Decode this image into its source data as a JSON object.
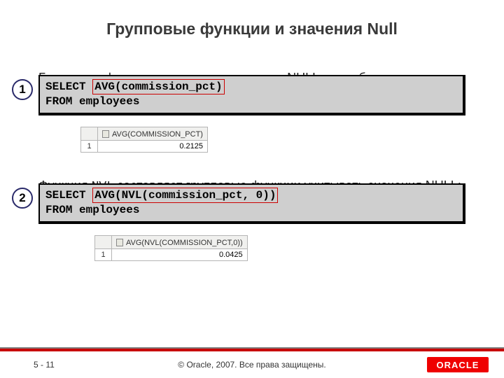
{
  "title": "Групповые функции и значения Null",
  "para1": "Групповые функции игнорируют значения NULL в столбцах:",
  "circle1": "1",
  "code1_select": "SELECT ",
  "code1_hl": "AVG(commission_pct)",
  "code1_from": "FROM   employees",
  "result1_header": "AVG(COMMISSION_PCT)",
  "result1_rownum": "1",
  "result1_value": "0.2125",
  "para2_pre": "Функция ",
  "para2_nvl": "NVL",
  "para2_post": " заставляет групповые функции учитывать значения NULL:",
  "circle2": "2",
  "code2_select": "SELECT ",
  "code2_hl": "AVG(NVL(commission_pct, 0))",
  "code2_from": "FROM   employees",
  "result2_header": "AVG(NVL(COMMISSION_PCT,0))",
  "result2_rownum": "1",
  "result2_value": "0.0425",
  "page_num": "5 - 11",
  "copyright": "© Oracle, 2007. Все права защищены.",
  "logo": "ORACLE",
  "chart_data": {
    "type": "table",
    "title": "Групповые функции и значения Null",
    "series": [
      {
        "name": "AVG(COMMISSION_PCT)",
        "values": [
          0.2125
        ]
      },
      {
        "name": "AVG(NVL(COMMISSION_PCT,0))",
        "values": [
          0.0425
        ]
      }
    ]
  }
}
